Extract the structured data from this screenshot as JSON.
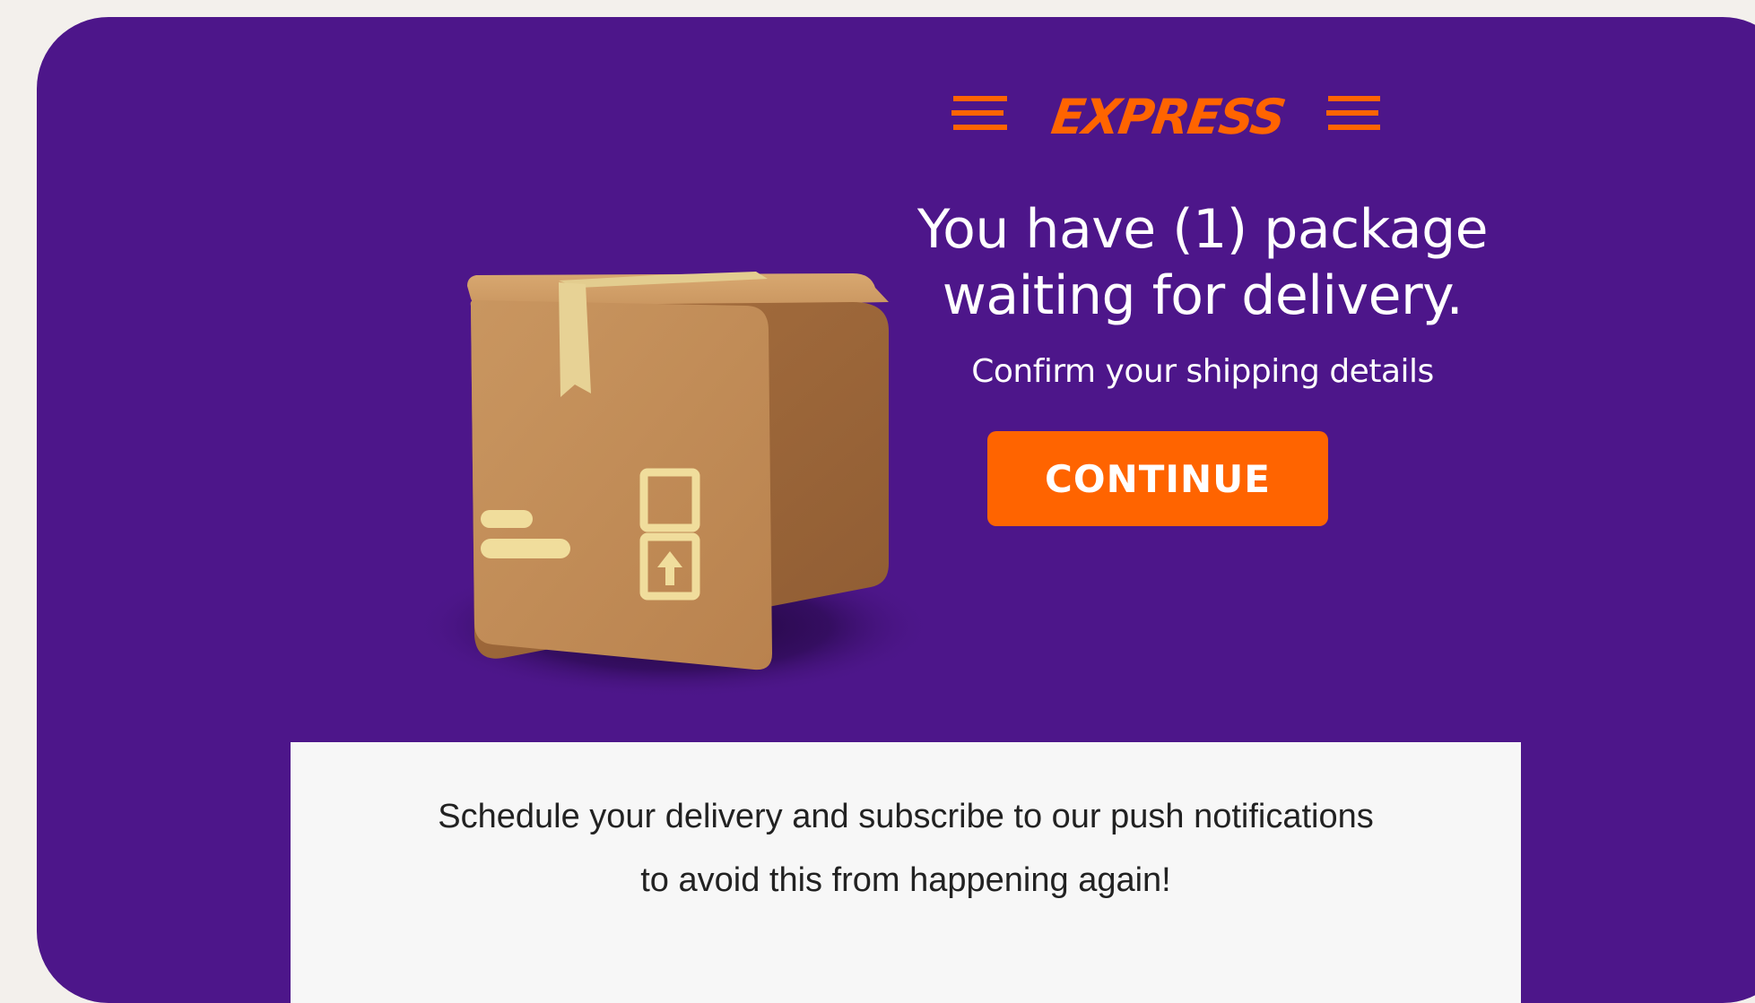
{
  "brand": {
    "logo_text": "EXPRESS",
    "accent_color": "#ff6400",
    "background_color": "#4d168a"
  },
  "hero": {
    "headline_line1": "You have (1) package",
    "headline_line2": "waiting for delivery.",
    "subline": "Confirm your shipping details",
    "cta_label": "CONTINUE",
    "illustration": "cardboard-box-icon"
  },
  "footer": {
    "line1": "Schedule your delivery and subscribe to our push notifications",
    "line2": "to avoid this from happening again!"
  }
}
